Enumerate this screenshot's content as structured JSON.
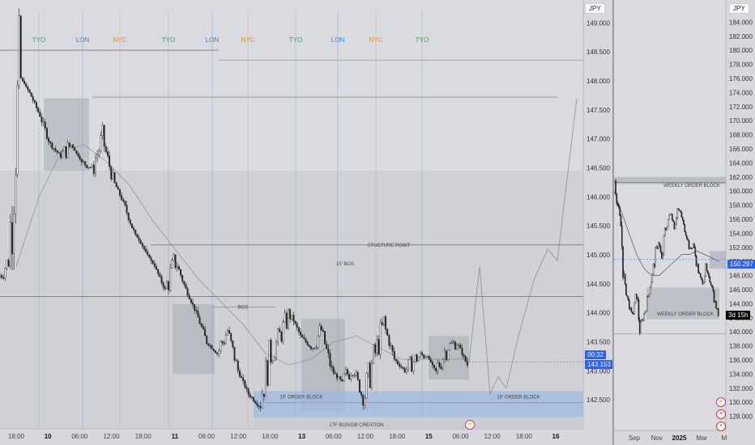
{
  "chart_data": [
    {
      "type": "candlestick",
      "currency": "JPY",
      "timeframe_hint": "15m",
      "ylim": [
        142.0,
        149.2
      ],
      "y_ticks": [
        "149.000",
        "148.500",
        "148.000",
        "147.500",
        "147.000",
        "146.500",
        "146.000",
        "145.500",
        "145.000",
        "144.500",
        "144.000",
        "143.500",
        "143.000",
        "142.500"
      ],
      "x_ticks": [
        {
          "label": "18:00",
          "bold": false
        },
        {
          "label": "10",
          "bold": true
        },
        {
          "label": "06:00",
          "bold": false
        },
        {
          "label": "12:00",
          "bold": false
        },
        {
          "label": "18:00",
          "bold": false
        },
        {
          "label": "11",
          "bold": true
        },
        {
          "label": "06:00",
          "bold": false
        },
        {
          "label": "12:00",
          "bold": false
        },
        {
          "label": "18:00",
          "bold": false
        },
        {
          "label": "13",
          "bold": true
        },
        {
          "label": "06:00",
          "bold": false
        },
        {
          "label": "12:00",
          "bold": false
        },
        {
          "label": "18:00",
          "bold": false
        },
        {
          "label": "15",
          "bold": true
        },
        {
          "label": "06:00",
          "bold": false
        },
        {
          "label": "12:00",
          "bold": false
        },
        {
          "label": "18:00",
          "bold": false
        },
        {
          "label": "16",
          "bold": true
        }
      ],
      "sessions": [
        {
          "label": "TYO",
          "color": "#3f9d4f"
        },
        {
          "label": "LON",
          "color": "#3b82c9"
        },
        {
          "label": "NYC",
          "color": "#e08a2a"
        },
        {
          "label": "TYO",
          "color": "#3f9d4f"
        },
        {
          "label": "LON",
          "color": "#3b82c9"
        },
        {
          "label": "NYC",
          "color": "#e08a2a"
        },
        {
          "label": "TYO",
          "color": "#3f9d4f"
        },
        {
          "label": "LON",
          "color": "#3b82c9"
        },
        {
          "label": "NYC",
          "color": "#e08a2a"
        },
        {
          "label": "TYO",
          "color": "#3f9d4f"
        }
      ],
      "series_close": [
        144.6,
        144.9,
        148.1,
        147.8,
        147.4,
        146.9,
        146.7,
        146.9,
        146.6,
        146.5,
        147.0,
        146.3,
        145.9,
        145.4,
        145.1,
        144.8,
        144.4,
        144.9,
        144.4,
        144.0,
        143.5,
        143.3,
        143.7,
        143.0,
        142.6,
        142.4,
        143.2,
        143.6,
        144.0,
        143.6,
        143.4,
        143.7,
        143.0,
        142.8,
        143.1,
        142.5,
        143.2,
        143.8,
        143.2,
        143.0,
        143.2,
        143.3,
        143.0,
        143.4,
        143.5,
        143.1
      ],
      "projection": [
        143.15,
        144.8,
        142.6,
        142.9,
        142.7,
        143.6,
        144.6,
        145.1,
        144.9,
        147.7
      ],
      "levels": [
        {
          "label": "STUCTURE POINT",
          "price": 145.17
        },
        {
          "label": "15' BOS",
          "price": 145.0
        },
        {
          "label": "BOS",
          "price": 144.1
        }
      ],
      "zones": [
        {
          "label": "15' ORDER BLOCK",
          "from": 142.2,
          "to": 142.65
        },
        {
          "label": "LTF BOS/OB CREATION",
          "from": 142.0,
          "to": 142.2
        }
      ],
      "current_price": "143.153",
      "countdown": "00:32"
    },
    {
      "type": "candlestick",
      "currency": "JPY",
      "timeframe_hint": "daily",
      "ylim": [
        126.0,
        186.0
      ],
      "y_ticks": [
        "184.000",
        "182.000",
        "180.000",
        "178.000",
        "176.000",
        "174.000",
        "172.000",
        "170.000",
        "168.000",
        "166.000",
        "164.000",
        "162.000",
        "160.000",
        "158.000",
        "156.000",
        "154.000",
        "152.000",
        "150.000",
        "148.000",
        "146.000",
        "144.000",
        "142.000",
        "140.000",
        "138.000",
        "136.000",
        "134.000",
        "132.000",
        "130.000",
        "128.000"
      ],
      "x_ticks": [
        {
          "label": "Sep",
          "bold": false
        },
        {
          "label": "Nov",
          "bold": false
        },
        {
          "label": "2025",
          "bold": true
        },
        {
          "label": "Mar",
          "bold": false
        },
        {
          "label": "M",
          "bold": false
        }
      ],
      "series_close": [
        161.5,
        158.0,
        155.0,
        147.0,
        145.0,
        143.0,
        142.5,
        145.5,
        140.5,
        142.0,
        143.5,
        146.0,
        148.0,
        151.0,
        153.0,
        150.0,
        154.0,
        156.0,
        157.0,
        155.0,
        157.5,
        157.0,
        155.0,
        153.5,
        151.5,
        152.5,
        150.0,
        148.0,
        147.0,
        149.0,
        147.5,
        146.5,
        144.0,
        142.5
      ],
      "zones": [
        {
          "label": "WEEKLY ORDER BLOCK",
          "from": 161.0,
          "to": 162.0
        },
        {
          "label": "WEEKLY ORDER BLOCK",
          "from": 141.8,
          "to": 146.3
        }
      ],
      "price_tags": [
        {
          "value": "150.297",
          "color": "#2962ff"
        },
        {
          "value": "3d 15h",
          "color": "#000000"
        }
      ]
    }
  ]
}
